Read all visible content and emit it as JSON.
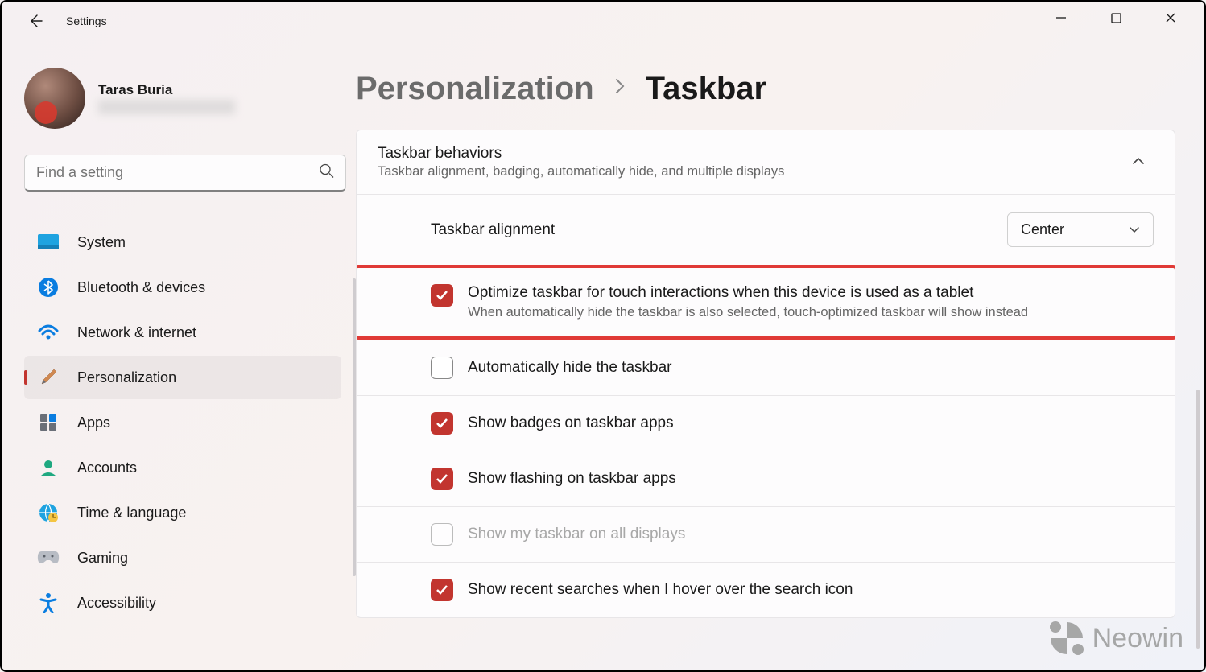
{
  "app": {
    "title": "Settings"
  },
  "profile": {
    "name": "Taras Buria"
  },
  "search": {
    "placeholder": "Find a setting"
  },
  "sidebar": {
    "items": [
      {
        "label": "System"
      },
      {
        "label": "Bluetooth & devices"
      },
      {
        "label": "Network & internet"
      },
      {
        "label": "Personalization"
      },
      {
        "label": "Apps"
      },
      {
        "label": "Accounts"
      },
      {
        "label": "Time & language"
      },
      {
        "label": "Gaming"
      },
      {
        "label": "Accessibility"
      }
    ]
  },
  "breadcrumb": {
    "parent": "Personalization",
    "current": "Taskbar"
  },
  "card": {
    "title": "Taskbar behaviors",
    "subtitle": "Taskbar alignment, badging, automatically hide, and multiple displays"
  },
  "rows": {
    "alignment": {
      "label": "Taskbar alignment",
      "value": "Center"
    },
    "optimize": {
      "label": "Optimize taskbar for touch interactions when this device is used as a tablet",
      "sub": "When automatically hide the taskbar is also selected, touch-optimized taskbar will show instead",
      "checked": true
    },
    "autohide": {
      "label": "Automatically hide the taskbar",
      "checked": false
    },
    "badges": {
      "label": "Show badges on taskbar apps",
      "checked": true
    },
    "flashing": {
      "label": "Show flashing on taskbar apps",
      "checked": true
    },
    "alldisplays": {
      "label": "Show my taskbar on all displays",
      "checked": false,
      "disabled": true
    },
    "searches": {
      "label": "Show recent searches when I hover over the search icon",
      "checked": true
    }
  },
  "watermark": {
    "text": "Neowin"
  }
}
